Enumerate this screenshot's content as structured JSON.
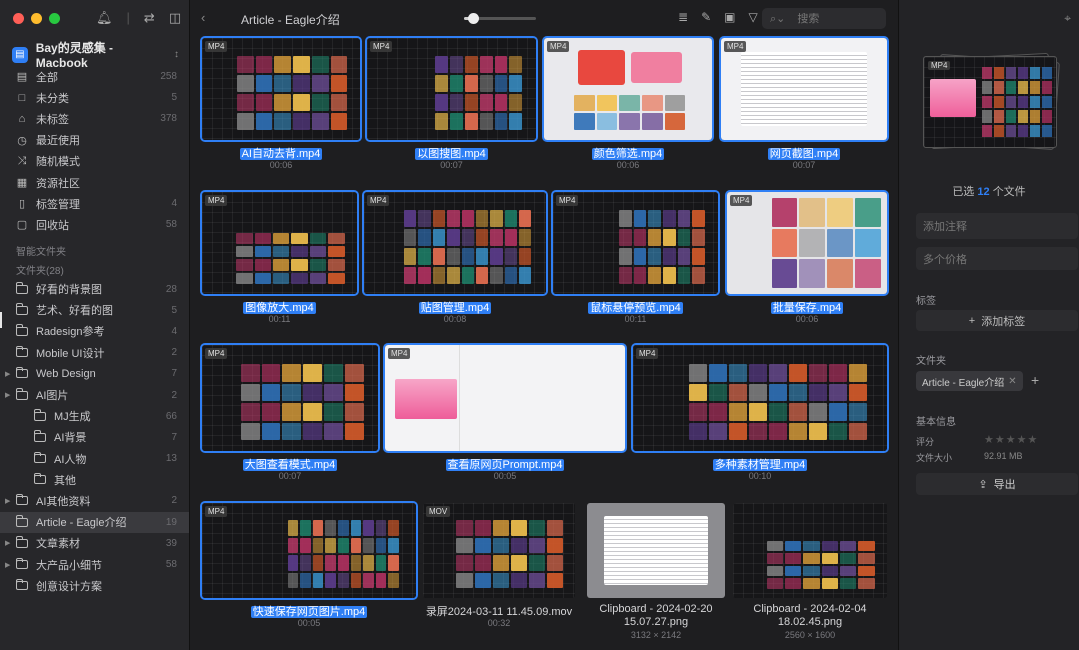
{
  "sidebar": {
    "library_name": "Bay的灵感集 - Macbook",
    "nav": [
      {
        "name": "all",
        "label": "全部",
        "count": "258",
        "icon": "stack-icon"
      },
      {
        "name": "uncategorized",
        "label": "未分类",
        "count": "5",
        "icon": "folder-icon"
      },
      {
        "name": "untagged",
        "label": "未标签",
        "count": "378",
        "icon": "tag-icon"
      },
      {
        "name": "recent",
        "label": "最近使用",
        "count": "",
        "icon": "clock-icon"
      },
      {
        "name": "random",
        "label": "随机模式",
        "count": "",
        "icon": "shuffle-icon"
      },
      {
        "name": "community",
        "label": "资源社区",
        "count": "",
        "icon": "community-icon"
      },
      {
        "name": "tag-manage",
        "label": "标签管理",
        "count": "4",
        "icon": "bookmark-icon"
      },
      {
        "name": "trash",
        "label": "回收站",
        "count": "58",
        "icon": "trash-icon"
      }
    ],
    "smart_folders_label": "智能文件夹",
    "folders_label": "文件夹(28)",
    "folders": [
      {
        "label": "好看的背景图",
        "count": "28",
        "expand": false,
        "indent": 0
      },
      {
        "label": "艺术、好看的图",
        "count": "5",
        "expand": false,
        "indent": 0
      },
      {
        "label": "Radesign参考",
        "count": "4",
        "expand": false,
        "indent": 0
      },
      {
        "label": "Mobile UI设计",
        "count": "2",
        "expand": false,
        "indent": 0
      },
      {
        "label": "Web Design",
        "count": "7",
        "expand": true,
        "indent": 0
      },
      {
        "label": "AI图片",
        "count": "2",
        "expand": true,
        "indent": 0
      },
      {
        "label": "MJ生成",
        "count": "66",
        "expand": false,
        "indent": 1
      },
      {
        "label": "AI背景",
        "count": "7",
        "expand": false,
        "indent": 1
      },
      {
        "label": "AI人物",
        "count": "13",
        "expand": false,
        "indent": 1
      },
      {
        "label": "其他",
        "count": "",
        "expand": false,
        "indent": 1
      },
      {
        "label": "AI其他资料",
        "count": "2",
        "expand": true,
        "indent": 0
      },
      {
        "label": "Article - Eagle介绍",
        "count": "19",
        "expand": false,
        "indent": 0,
        "active": true
      },
      {
        "label": "文章素材",
        "count": "39",
        "expand": true,
        "indent": 0
      },
      {
        "label": "大产品小细节",
        "count": "58",
        "expand": true,
        "indent": 0
      },
      {
        "label": "创意设计方案",
        "count": "",
        "expand": false,
        "indent": 0
      }
    ]
  },
  "toolbar": {
    "breadcrumb": "Article - Eagle介绍",
    "search_placeholder": "搜索",
    "zoom_level": 0.13
  },
  "items": [
    {
      "title": "AI自动去背.mp4",
      "sub": "00:06",
      "type": "MP4",
      "selected": true
    },
    {
      "title": "以图搜图.mp4",
      "sub": "00:07",
      "type": "MP4",
      "selected": true
    },
    {
      "title": "颜色筛选.mp4",
      "sub": "00:06",
      "type": "MP4",
      "selected": true
    },
    {
      "title": "网页截图.mp4",
      "sub": "00:07",
      "type": "MP4",
      "selected": true
    },
    {
      "title": "图像放大.mp4",
      "sub": "00:11",
      "type": "MP4",
      "selected": true
    },
    {
      "title": "贴图管理.mp4",
      "sub": "00:08",
      "type": "MP4",
      "selected": true
    },
    {
      "title": "鼠标悬停预览.mp4",
      "sub": "00:11",
      "type": "MP4",
      "selected": true
    },
    {
      "title": "批量保存.mp4",
      "sub": "00:06",
      "type": "MP4",
      "selected": true
    },
    {
      "title": "大图查看模式.mp4",
      "sub": "00:07",
      "type": "MP4",
      "selected": true
    },
    {
      "title": "查看原网页Prompt.mp4",
      "sub": "00:05",
      "type": "MP4",
      "selected": true
    },
    {
      "title": "多种素材管理.mp4",
      "sub": "00:10",
      "type": "MP4",
      "selected": true
    },
    {
      "title": "快速保存网页图片.mp4",
      "sub": "00:05",
      "type": "MP4",
      "selected": true
    },
    {
      "title": "录屏2024-03-11 11.45.09.mov",
      "sub": "00:32",
      "type": "MOV",
      "selected": false
    },
    {
      "title": "Clipboard - 2024-02-20",
      "title2": "15.07.27.png",
      "sub": "3132 × 2142",
      "type": "",
      "selected": false
    },
    {
      "title": "Clipboard - 2024-02-04",
      "title2": "18.02.45.png",
      "sub": "2560 × 1600",
      "type": "",
      "selected": false
    }
  ],
  "inspector": {
    "selected_prefix": "已选",
    "selected_count": "12",
    "selected_suffix": "个文件",
    "note_placeholder": "添加注释",
    "url_placeholder": "多个价格",
    "tags_label": "标签",
    "add_tag_label": "添加标签",
    "folders_label": "文件夹",
    "folder_chip": "Article - Eagle介绍",
    "basic_info_label": "基本信息",
    "rating_label": "评分",
    "rating_value": 0,
    "size_label": "文件大小",
    "size_value": "92.91 MB",
    "export_label": "导出"
  },
  "colors": {
    "accent": "#2f7ff5",
    "sidebar_bg": "#27272a",
    "main_bg": "#1e1e20"
  }
}
